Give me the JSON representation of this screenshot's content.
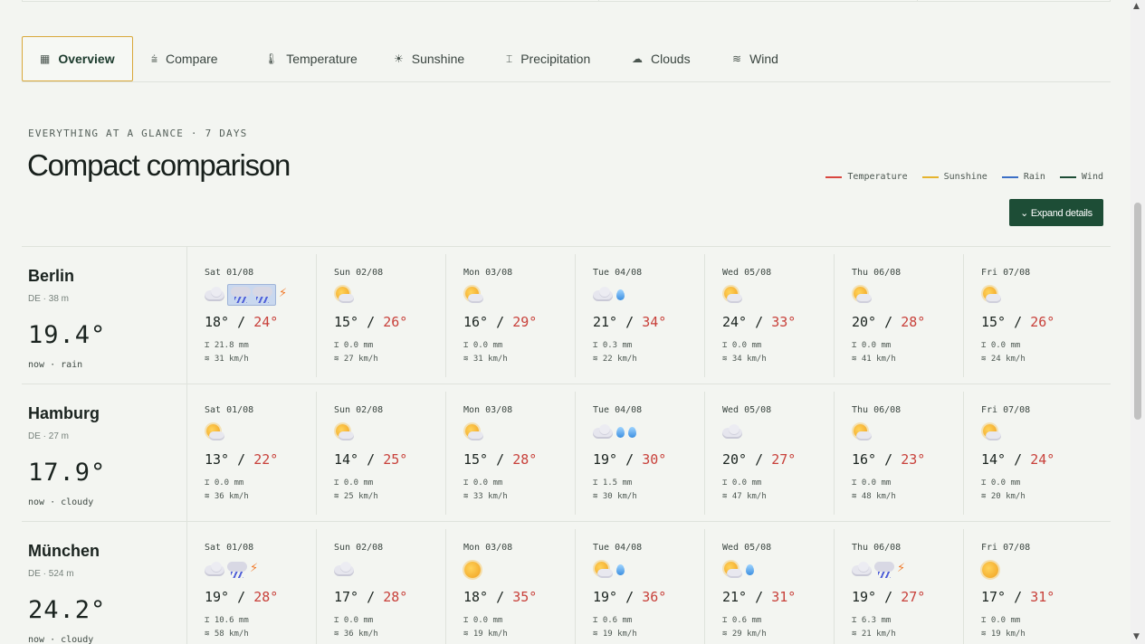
{
  "tabs": [
    {
      "label": "Overview",
      "icon": "table-icon",
      "glyph": "▦",
      "active": true
    },
    {
      "label": "Compare",
      "icon": "compare-icon",
      "glyph": "⩭"
    },
    {
      "label": "Temperature",
      "icon": "thermometer-icon",
      "glyph": "🌡"
    },
    {
      "label": "Sunshine",
      "icon": "sun-icon",
      "glyph": "☀"
    },
    {
      "label": "Precipitation",
      "icon": "precipitation-icon",
      "glyph": "⌶"
    },
    {
      "label": "Clouds",
      "icon": "cloud-icon",
      "glyph": "☁"
    },
    {
      "label": "Wind",
      "icon": "wind-icon",
      "glyph": "≋"
    }
  ],
  "header": {
    "eyebrow": "EVERYTHING AT A GLANCE · 7 DAYS",
    "title": "Compact comparison",
    "expand_label": "⌄ Expand details"
  },
  "legend": [
    {
      "label": "Temperature",
      "color": "#d9473f"
    },
    {
      "label": "Sunshine",
      "color": "#e6b42e"
    },
    {
      "label": "Rain",
      "color": "#3b6fc6"
    },
    {
      "label": "Wind",
      "color": "#1d4d36"
    }
  ],
  "cities": [
    {
      "name": "Berlin",
      "meta": "DE · 38 m",
      "now_temp": "19.4°",
      "now_text": "now · rain",
      "days": [
        {
          "label": "Sat 01/08",
          "icons": [
            "cloud",
            "storm-hl",
            "bolt"
          ],
          "lo": "18°",
          "hi": "24°",
          "rain": "21.8 mm",
          "wind": "31 km/h"
        },
        {
          "label": "Sun 02/08",
          "icons": [
            "partly"
          ],
          "lo": "15°",
          "hi": "26°",
          "rain": "0.0 mm",
          "wind": "27 km/h"
        },
        {
          "label": "Mon 03/08",
          "icons": [
            "partly"
          ],
          "lo": "16°",
          "hi": "29°",
          "rain": "0.0 mm",
          "wind": "31 km/h"
        },
        {
          "label": "Tue 04/08",
          "icons": [
            "cloud",
            "drop"
          ],
          "lo": "21°",
          "hi": "34°",
          "rain": "0.3 mm",
          "wind": "22 km/h"
        },
        {
          "label": "Wed 05/08",
          "icons": [
            "partly"
          ],
          "lo": "24°",
          "hi": "33°",
          "rain": "0.0 mm",
          "wind": "34 km/h"
        },
        {
          "label": "Thu 06/08",
          "icons": [
            "partly"
          ],
          "lo": "20°",
          "hi": "28°",
          "rain": "0.0 mm",
          "wind": "41 km/h"
        },
        {
          "label": "Fri 07/08",
          "icons": [
            "partly"
          ],
          "lo": "15°",
          "hi": "26°",
          "rain": "0.0 mm",
          "wind": "24 km/h"
        }
      ]
    },
    {
      "name": "Hamburg",
      "meta": "DE · 27 m",
      "now_temp": "17.9°",
      "now_text": "now · cloudy",
      "days": [
        {
          "label": "Sat 01/08",
          "icons": [
            "partly"
          ],
          "lo": "13°",
          "hi": "22°",
          "rain": "0.0 mm",
          "wind": "36 km/h"
        },
        {
          "label": "Sun 02/08",
          "icons": [
            "partly"
          ],
          "lo": "14°",
          "hi": "25°",
          "rain": "0.0 mm",
          "wind": "25 km/h"
        },
        {
          "label": "Mon 03/08",
          "icons": [
            "partly"
          ],
          "lo": "15°",
          "hi": "28°",
          "rain": "0.0 mm",
          "wind": "33 km/h"
        },
        {
          "label": "Tue 04/08",
          "icons": [
            "cloud",
            "drop",
            "drop"
          ],
          "lo": "19°",
          "hi": "30°",
          "rain": "1.5 mm",
          "wind": "30 km/h"
        },
        {
          "label": "Wed 05/08",
          "icons": [
            "cloud"
          ],
          "lo": "20°",
          "hi": "27°",
          "rain": "0.0 mm",
          "wind": "47 km/h"
        },
        {
          "label": "Thu 06/08",
          "icons": [
            "partly"
          ],
          "lo": "16°",
          "hi": "23°",
          "rain": "0.0 mm",
          "wind": "48 km/h"
        },
        {
          "label": "Fri 07/08",
          "icons": [
            "partly"
          ],
          "lo": "14°",
          "hi": "24°",
          "rain": "0.0 mm",
          "wind": "20 km/h"
        }
      ]
    },
    {
      "name": "München",
      "meta": "DE · 524 m",
      "now_temp": "24.2°",
      "now_text": "now · cloudy",
      "days": [
        {
          "label": "Sat 01/08",
          "icons": [
            "cloud",
            "storm",
            "bolt"
          ],
          "lo": "19°",
          "hi": "28°",
          "rain": "10.6 mm",
          "wind": "58 km/h"
        },
        {
          "label": "Sun 02/08",
          "icons": [
            "cloud"
          ],
          "lo": "17°",
          "hi": "28°",
          "rain": "0.0 mm",
          "wind": "36 km/h"
        },
        {
          "label": "Mon 03/08",
          "icons": [
            "sun"
          ],
          "lo": "18°",
          "hi": "35°",
          "rain": "0.0 mm",
          "wind": "19 km/h"
        },
        {
          "label": "Tue 04/08",
          "icons": [
            "partly",
            "drop"
          ],
          "lo": "19°",
          "hi": "36°",
          "rain": "0.6 mm",
          "wind": "19 km/h"
        },
        {
          "label": "Wed 05/08",
          "icons": [
            "partly",
            "drop"
          ],
          "lo": "21°",
          "hi": "31°",
          "rain": "0.6 mm",
          "wind": "29 km/h"
        },
        {
          "label": "Thu 06/08",
          "icons": [
            "cloud",
            "storm",
            "bolt"
          ],
          "lo": "19°",
          "hi": "27°",
          "rain": "6.3 mm",
          "wind": "21 km/h"
        },
        {
          "label": "Fri 07/08",
          "icons": [
            "sun"
          ],
          "lo": "17°",
          "hi": "31°",
          "rain": "0.0 mm",
          "wind": "19 km/h"
        }
      ]
    }
  ],
  "glyphs": {
    "rain": "⌶",
    "wind": "≋"
  }
}
